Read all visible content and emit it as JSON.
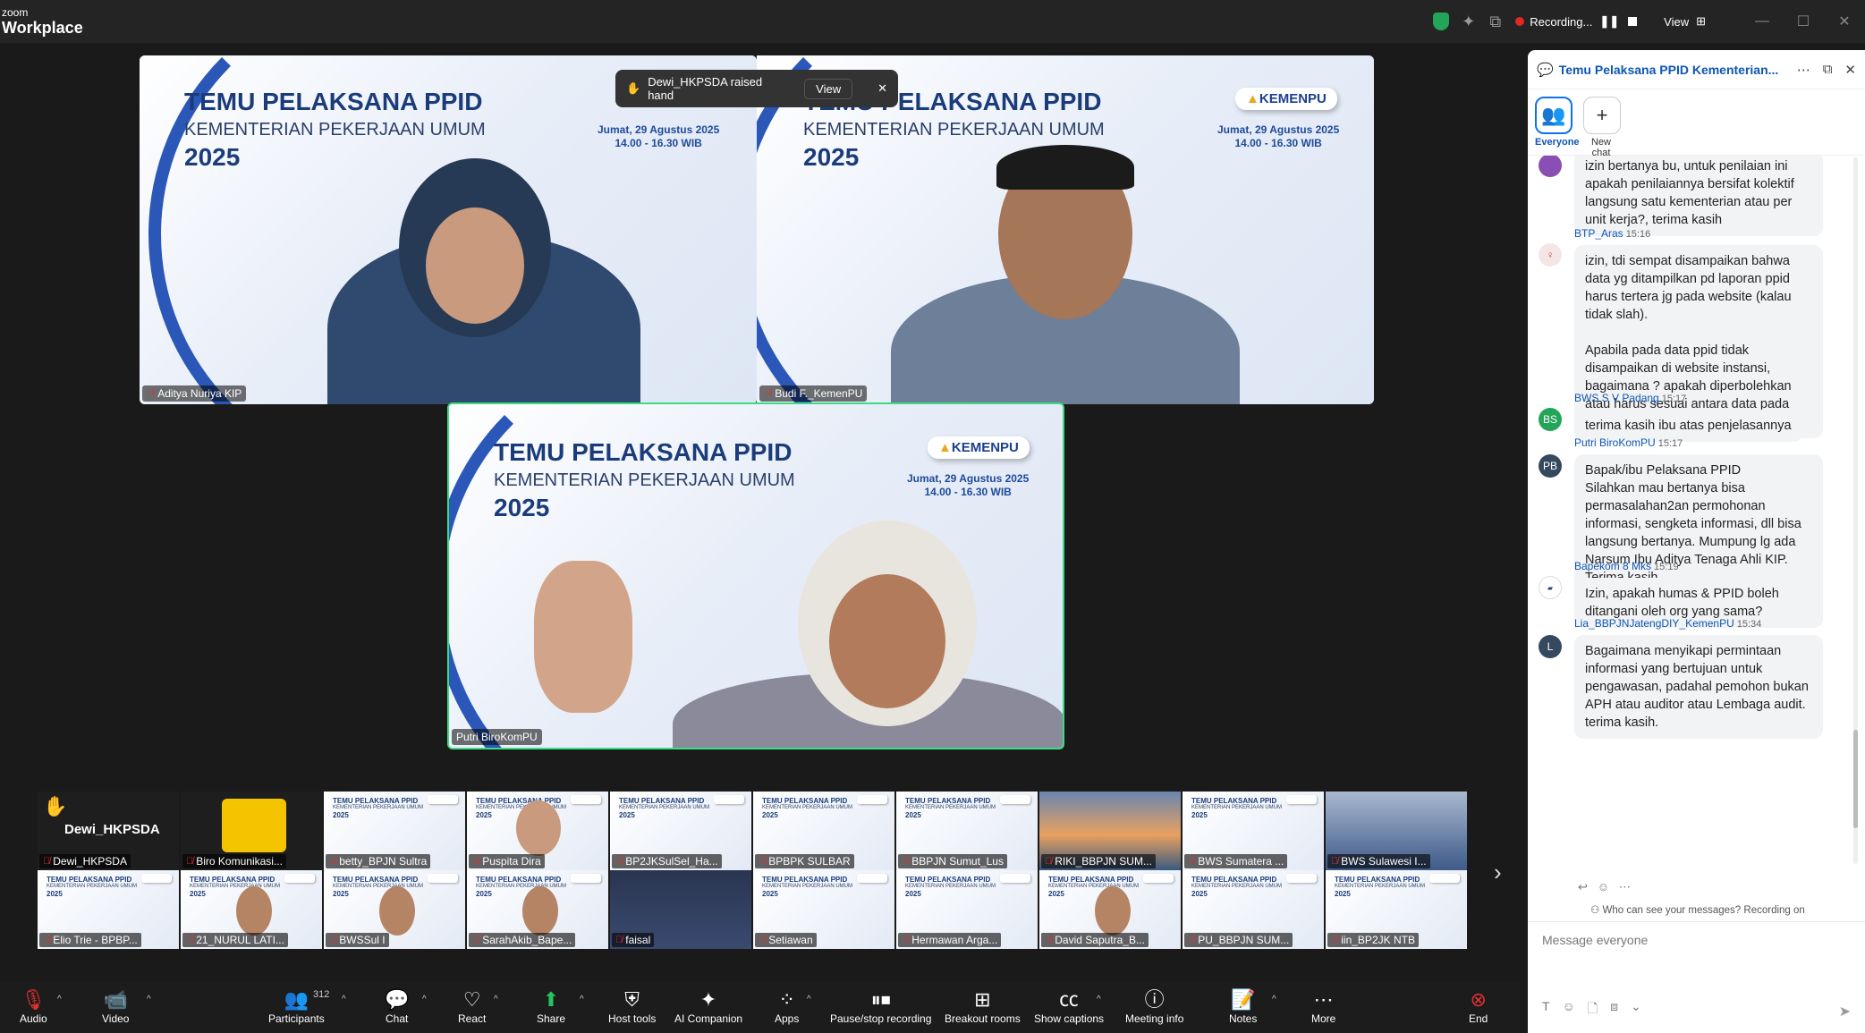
{
  "topbar": {
    "logo_top": "zoom",
    "logo_bottom": "Workplace",
    "recording_label": "Recording...",
    "view_label": "View"
  },
  "notification": {
    "text": "Dewi_HKPSDA raised hand",
    "view_button": "View"
  },
  "slide": {
    "title": "TEMU PELAKSANA PPID",
    "subtitle": "KEMENTERIAN PEKERJAAN UMUM",
    "year": "2025",
    "date": "Jumat, 29 Agustus 2025",
    "time": "14.00 - 16.30 WIB",
    "logo_text": "KEMENPU"
  },
  "main_tiles": [
    {
      "name": "Aditya Nuriya KIP"
    },
    {
      "name": "Budi F._KemenPU"
    },
    {
      "name": "Putri BiroKomPU"
    }
  ],
  "strip": {
    "row1": [
      "Dewi_HKPSDA",
      "Biro Komunikasi...",
      "betty_BPJN Sultra",
      "Puspita Dira",
      "BP2JKSulSel_Ha...",
      "BPBPK SULBAR",
      "BBPJN Sumut_Lus",
      "RIKI_BBPJN SUM...",
      "BWS Sumatera ...",
      "BWS Sulawesi I..."
    ],
    "row2": [
      "Elio Trie - BPBP...",
      "21_NURUL LATI...",
      "BWSSul I",
      "SarahAkib_Bape...",
      "faisal",
      "Setiawan",
      "Hermawan Arga...",
      "David Saputra_B...",
      "PU_BBPJN SUM...",
      "iin_BP2JK NTB"
    ],
    "raised_name": "Dewi_HKPSDA"
  },
  "toolbar": {
    "audio": "Audio",
    "video": "Video",
    "participants": "Participants",
    "participants_count": "312",
    "chat": "Chat",
    "react": "React",
    "share": "Share",
    "host_tools": "Host tools",
    "ai_companion": "AI Companion",
    "apps": "Apps",
    "pause_recording": "Pause/stop recording",
    "breakout_rooms": "Breakout rooms",
    "show_captions": "Show captions",
    "meeting_info": "Meeting info",
    "notes": "Notes",
    "more": "More",
    "end": "End"
  },
  "chat": {
    "title": "Temu Pelaksana PPID Kementerian...",
    "chip_everyone": "Everyone",
    "chip_new": "New chat",
    "messages": [
      {
        "sender": "",
        "time": "",
        "text": "izin bertanya bu, untuk penilaian ini apakah penilaiannya bersifat kolektif langsung satu kementerian atau per unit kerja?, terima kasih"
      },
      {
        "sender": "BTP_Aras",
        "time": "15:16",
        "text": "izin, tdi sempat disampaikan bahwa data yg ditampilkan pd laporan ppid harus tertera jg pada website (kalau tidak slah).\n\nApabila pada data ppid tidak disampaikan  di website instansi, bagaimana ? apakah diperbolehkan atau harus sesuai antara data pada ppid dan website?"
      },
      {
        "sender": "BWS S V Padang",
        "time": "15:17",
        "avatar": "BS",
        "text": "terima kasih ibu atas penjelasannya"
      },
      {
        "sender": "Putri BiroKomPU",
        "time": "15:17",
        "avatar": "PB",
        "text": "Bapak/ibu Pelaksana PPID\nSilahkan mau bertanya bisa permasalahan2an permohonan informasi, sengketa informasi, dll bisa langsung bertanya. Mumpung lg ada Narsum Ibu Aditya Tenaga Ahli KIP. Terima kasih."
      },
      {
        "sender": "Bapekom 8 Mks",
        "time": "15:19",
        "text": "Izin, apakah humas & PPID boleh ditangani oleh org yang sama?"
      },
      {
        "sender": "Lia_BBPJNJatengDIY_KemenPU",
        "time": "15:34",
        "avatar": "L",
        "text": "Bagaimana menyikapi permintaan informasi yang bertujuan untuk pengawasan, padahal pemohon bukan APH atau auditor atau Lembaga audit. terima kasih."
      }
    ],
    "visibility_note": "Who can see your messages? Recording on",
    "input_placeholder": "Message everyone"
  },
  "colors": {
    "accent": "#0e72ed",
    "slide_blue": "#1b3c7a",
    "active_speaker": "#3ddc84",
    "recording": "#e02828"
  }
}
